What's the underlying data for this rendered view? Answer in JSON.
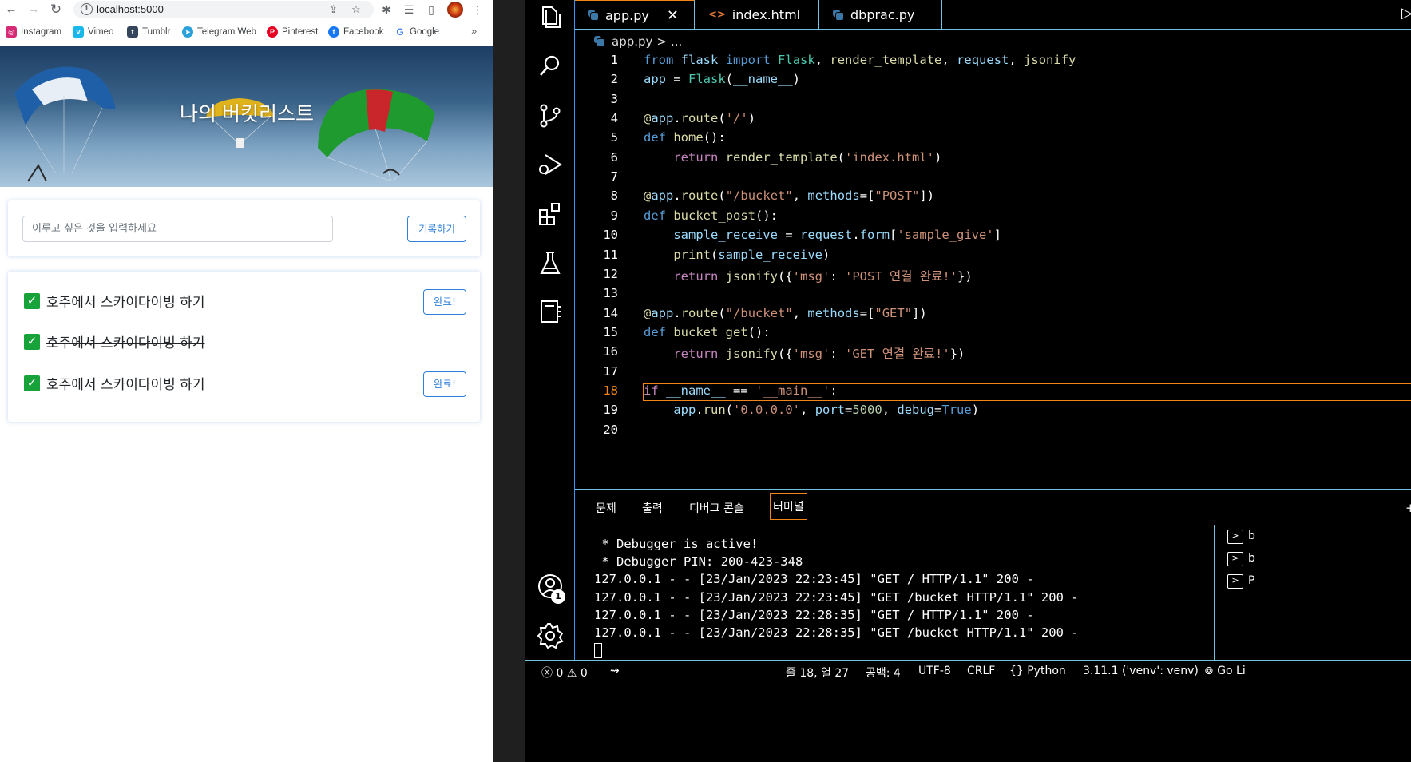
{
  "browser": {
    "url": "localhost:5000",
    "bookmarks": [
      {
        "label": "Instagram",
        "icon": "instagram-icon",
        "color": "#d62976"
      },
      {
        "label": "Vimeo",
        "icon": "vimeo-icon",
        "color": "#1ab7ea"
      },
      {
        "label": "Tumblr",
        "icon": "tumblr-icon",
        "color": "#35465c"
      },
      {
        "label": "Telegram Web",
        "icon": "telegram-icon",
        "color": "#2aa1da"
      },
      {
        "label": "Pinterest",
        "icon": "pinterest-icon",
        "color": "#e60023"
      },
      {
        "label": "Facebook",
        "icon": "facebook-icon",
        "color": "#1877f2"
      },
      {
        "label": "Google",
        "icon": "google-icon",
        "color": "#4285f4"
      }
    ],
    "page": {
      "title": "나의 버킷리스트",
      "input_placeholder": "이루고 싶은 것을 입력하세요",
      "save_label": "기록하기",
      "items": [
        {
          "text": "호주에서 스카이다이빙 하기",
          "done": false,
          "button": "완료!"
        },
        {
          "text": "호주에서 스카이다이빙 하기",
          "done": true
        },
        {
          "text": "호주에서 스카이다이빙 하기",
          "done": false,
          "button": "완료!"
        }
      ]
    }
  },
  "vscode": {
    "tabs": [
      {
        "label": "app.py",
        "icon": "python-icon",
        "active": true,
        "close": "✕"
      },
      {
        "label": "index.html",
        "icon": "html-icon",
        "active": false
      },
      {
        "label": "dbprac.py",
        "icon": "python-icon",
        "active": false
      }
    ],
    "breadcrumb": {
      "file": "app.py",
      "sep": ">",
      "rest": "..."
    },
    "line_numbers": [
      "1",
      "2",
      "3",
      "4",
      "5",
      "6",
      "7",
      "8",
      "9",
      "10",
      "11",
      "12",
      "13",
      "14",
      "15",
      "16",
      "17",
      "18",
      "19",
      "20"
    ],
    "current_line": "18",
    "code_lines": [
      "from flask import Flask, render_template, request, jsonify",
      "app = Flask(__name__)",
      "",
      "@app.route('/')",
      "def home():",
      "    return render_template('index.html')",
      "",
      "@app.route(\"/bucket\", methods=[\"POST\"])",
      "def bucket_post():",
      "    sample_receive = request.form['sample_give']",
      "    print(sample_receive)",
      "    return jsonify({'msg': 'POST 연결 완료!'})",
      "",
      "@app.route(\"/bucket\", methods=[\"GET\"])",
      "def bucket_get():",
      "    return jsonify({'msg': 'GET 연결 완료!'})",
      "",
      "if __name__ == '__main__':",
      "    app.run('0.0.0.0', port=5000, debug=True)",
      ""
    ],
    "panel_tabs": [
      "문제",
      "출력",
      "디버그 콘솔",
      "터미널"
    ],
    "active_panel_tab": "터미널",
    "terminal_lines": [
      " * Debugger is active!",
      " * Debugger PIN: 200-423-348",
      "127.0.0.1 - - [23/Jan/2023 22:23:45] \"GET / HTTP/1.1\" 200 -",
      "127.0.0.1 - - [23/Jan/2023 22:23:45] \"GET /bucket HTTP/1.1\" 200 -",
      "127.0.0.1 - - [23/Jan/2023 22:28:35] \"GET / HTTP/1.1\" 200 -",
      "127.0.0.1 - - [23/Jan/2023 22:28:35] \"GET /bucket HTTP/1.1\" 200 -"
    ],
    "terminal_list": [
      "b",
      "b",
      "P"
    ],
    "accounts_badge": "1",
    "status": {
      "errors": "0",
      "warnings": "0",
      "position": "줄 18, 열 27",
      "spaces": "공백: 4",
      "encoding": "UTF-8",
      "eol": "CRLF",
      "language": "Python",
      "interpreter": "3.11.1 ('venv': venv)",
      "golive": "Go Li"
    }
  }
}
